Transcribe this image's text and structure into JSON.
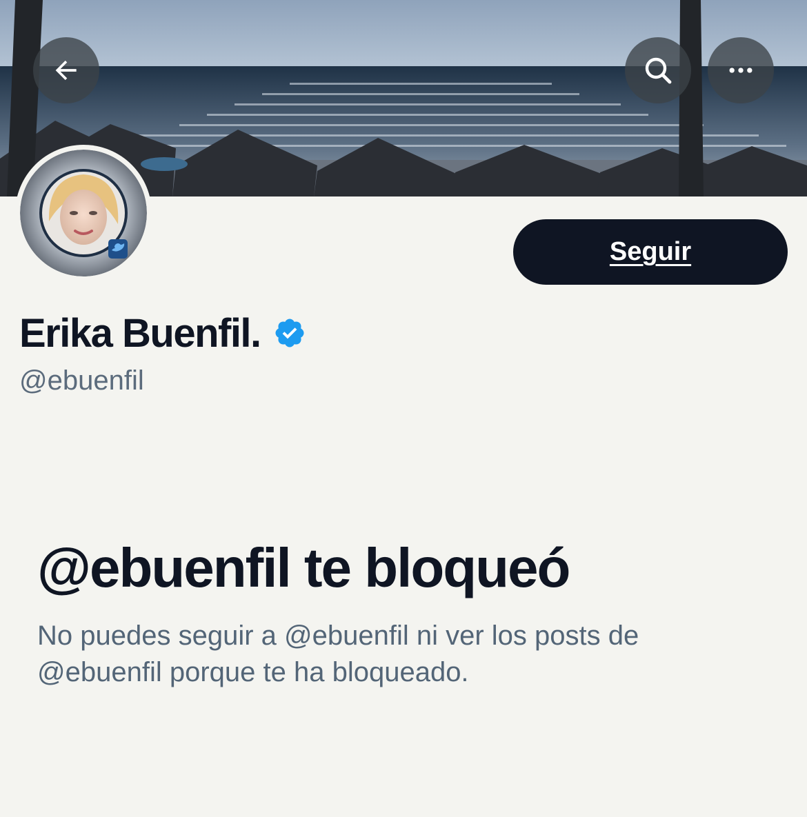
{
  "header": {
    "back_icon": "arrow-left-icon",
    "search_icon": "search-icon",
    "more_icon": "more-horizontal-icon"
  },
  "profile": {
    "display_name": "Erika Buenfil.",
    "handle": "@ebuenfil",
    "verified_icon": "verified-badge-icon",
    "verified_color": "#1d9bf0",
    "follow_label": "Seguir"
  },
  "blocked": {
    "title": "@ebuenfil te bloqueó",
    "description": "No puedes seguir a @ebuenfil ni ver los posts de @ebuenfil porque te ha bloqueado."
  },
  "colors": {
    "background": "#f4f4f0",
    "primary_text": "#0f1523",
    "secondary_text": "#536577",
    "button": "#0f1523"
  }
}
